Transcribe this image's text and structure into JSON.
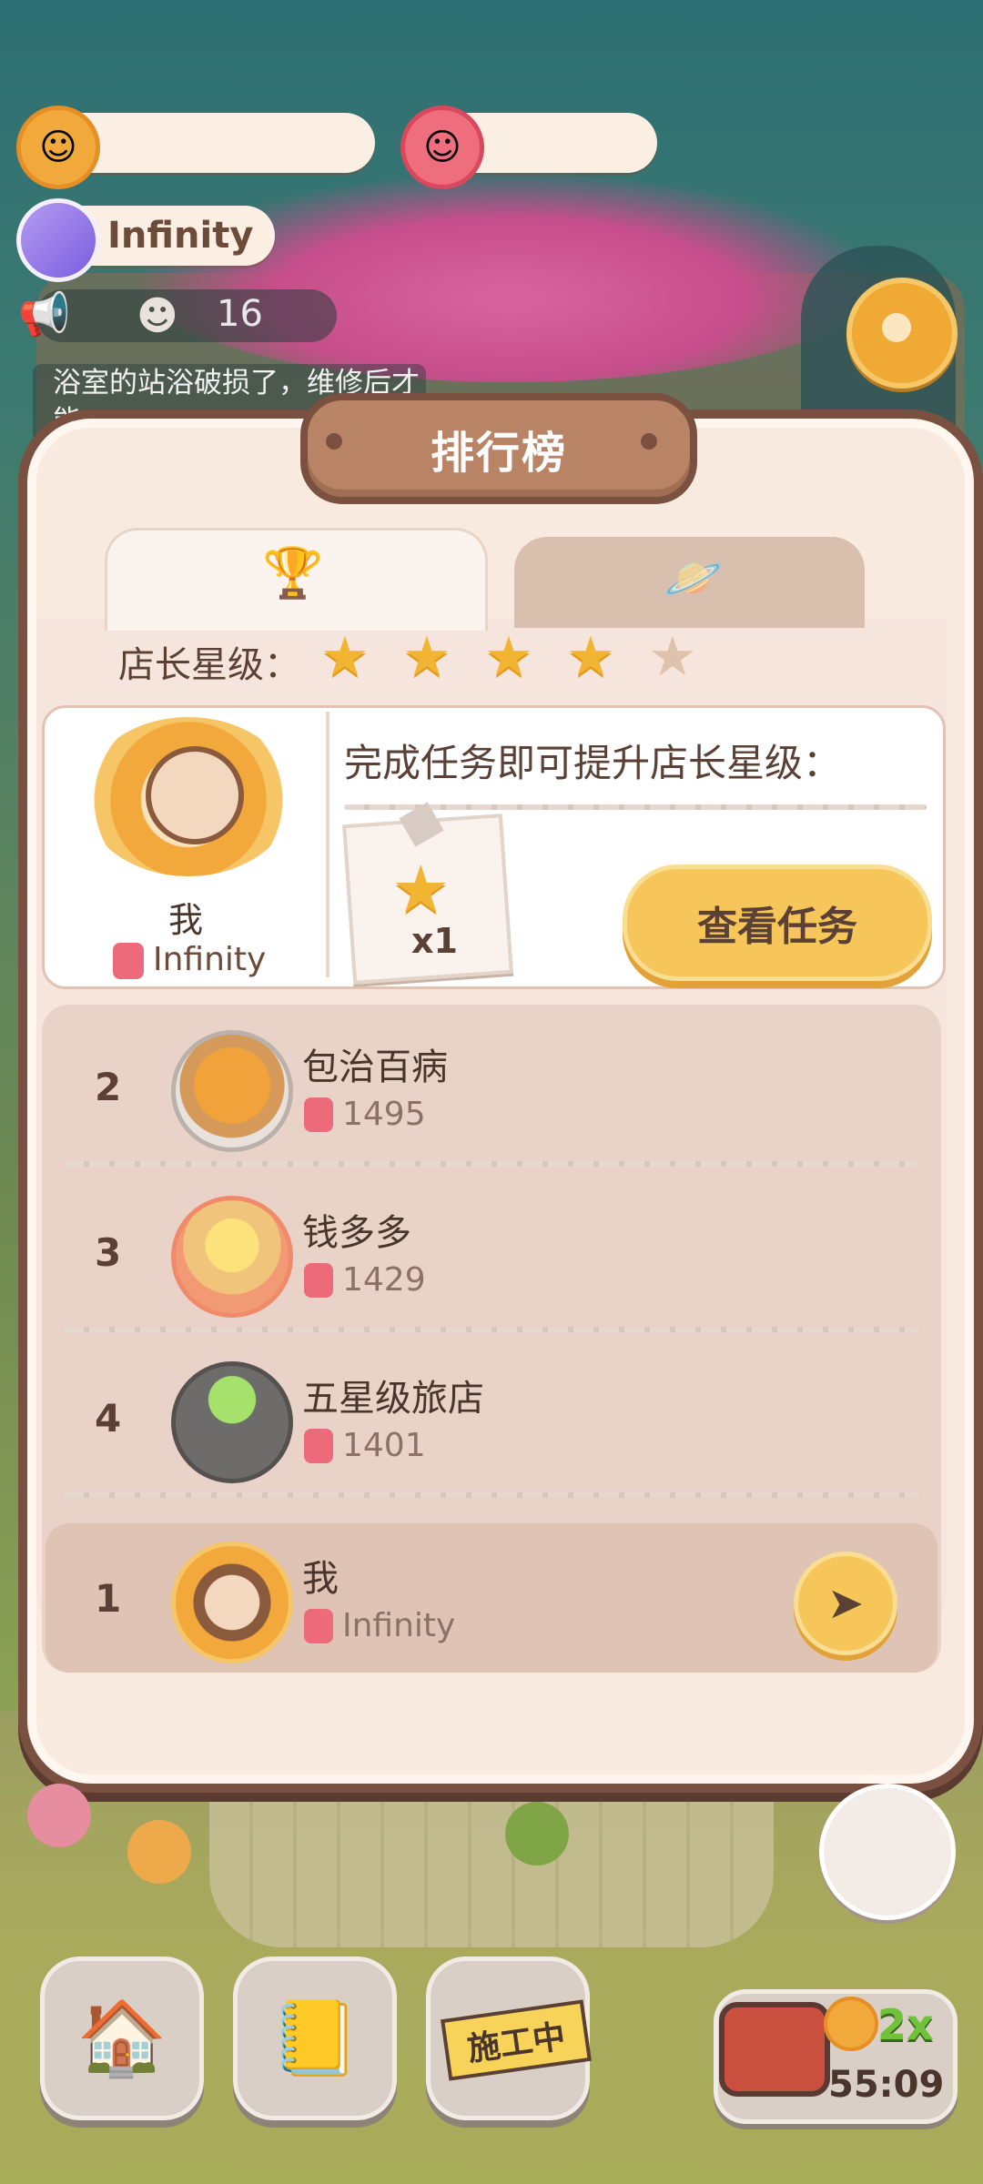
{
  "hud": {
    "infinity_label": "Infinity",
    "ghost_count": "16",
    "notice_text": "浴室的站浴破损了，维修后才能..."
  },
  "modal": {
    "title": "排行榜",
    "tabs": [
      {
        "icon": "trophy-icon",
        "active": true
      },
      {
        "icon": "planet-icon",
        "active": false
      }
    ],
    "stars_label": "店长星级：",
    "stars": [
      {
        "filled": true
      },
      {
        "filled": true
      },
      {
        "filled": true
      },
      {
        "filled": true
      },
      {
        "filled": false
      }
    ],
    "me_card": {
      "name": "我",
      "score": "Infinity",
      "task_prompt": "完成任务即可提升店长星级：",
      "reward_qty": "x1",
      "view_tasks_label": "查看任务"
    },
    "leaderboard": [
      {
        "rank": "2",
        "name": "包治百病",
        "score": "1495"
      },
      {
        "rank": "3",
        "name": "钱多多",
        "score": "1429"
      },
      {
        "rank": "4",
        "name": "五星级旅店",
        "score": "1401"
      }
    ],
    "my_row": {
      "rank": "1",
      "name": "我",
      "score": "Infinity"
    }
  },
  "bottom": {
    "construction_label": "施工中",
    "boost_label": "2x",
    "timer": "55:09"
  },
  "colors": {
    "accent": "#f7c65a",
    "frame": "#7a5140",
    "star": "#f2b433"
  }
}
